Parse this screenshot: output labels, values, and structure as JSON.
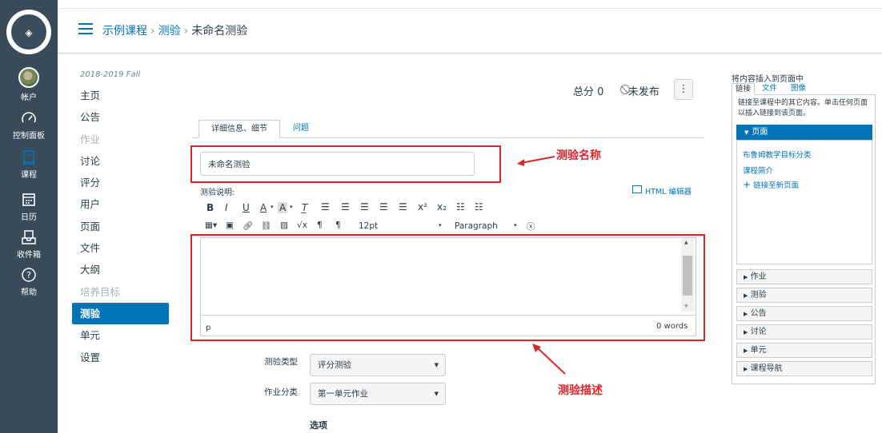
{
  "global_nav": {
    "account": "帐户",
    "dashboard": "控制面板",
    "courses": "课程",
    "calendar": "日历",
    "inbox": "收件箱",
    "help": "帮助"
  },
  "breadcrumbs": [
    "示例课程",
    "测验",
    "未命名测验"
  ],
  "course_nav": {
    "term": "2018-2019 Fall",
    "items": [
      "主页",
      "公告",
      "作业",
      "讨论",
      "评分",
      "用户",
      "页面",
      "文件",
      "大纲",
      "培养目标",
      "测验",
      "单元",
      "设置"
    ]
  },
  "quiz_header": {
    "points_label": "总分 0",
    "unpublished_label": "未发布",
    "options_button": "⋮"
  },
  "tabs": [
    "详细信息、细节",
    "问题"
  ],
  "title_input": {
    "value": "未命名测验"
  },
  "annotations": {
    "name": "测验名称",
    "description": "测验描述"
  },
  "description": {
    "label": "测验说明:",
    "html_editor_link": "HTML 编辑器",
    "font_size": "12pt",
    "block_format": "Paragraph",
    "status_path": "p",
    "word_count": "0 words"
  },
  "form": {
    "quiz_type_label": "测验类型",
    "quiz_type_value": "评分测验",
    "assignment_group_label": "作业分类",
    "assignment_group_value": "第一单元作业",
    "options_heading": "选项"
  },
  "content_sidebar": {
    "title": "将内容插入到页面中",
    "tabs": [
      "链接",
      "文件",
      "图像"
    ],
    "description": "链接至课程中的其它内容。单击任何页面以插入链接到该页面。",
    "pages_header": "页面",
    "page_links": [
      "布鲁姆教学目标分类",
      "课程简介",
      "链接至新页面"
    ],
    "sections": [
      "作业",
      "测验",
      "公告",
      "讨论",
      "单元",
      "课程导航"
    ]
  },
  "colors": {
    "nav_bg": "#394b58",
    "link": "#0374b5",
    "annotation_red": "#e0242a"
  }
}
